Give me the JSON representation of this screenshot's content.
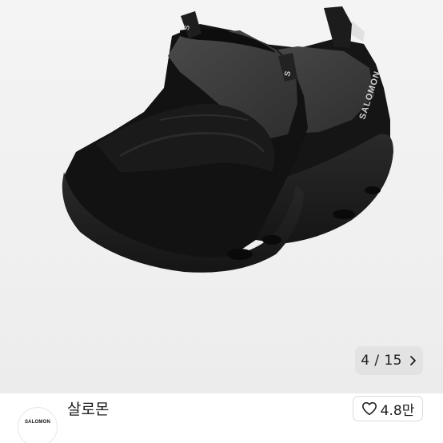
{
  "gallery": {
    "current": "4",
    "separator": "/",
    "total": "15",
    "image_alt": "product-photo-shoes"
  },
  "seller": {
    "avatar_text": "SALOMON",
    "name": "살로몬"
  },
  "like": {
    "count": "4.8만"
  },
  "shoe_logo_text": "SALOMON",
  "icons": {
    "next": "chevron-right-icon",
    "like": "heart-outline-icon"
  }
}
